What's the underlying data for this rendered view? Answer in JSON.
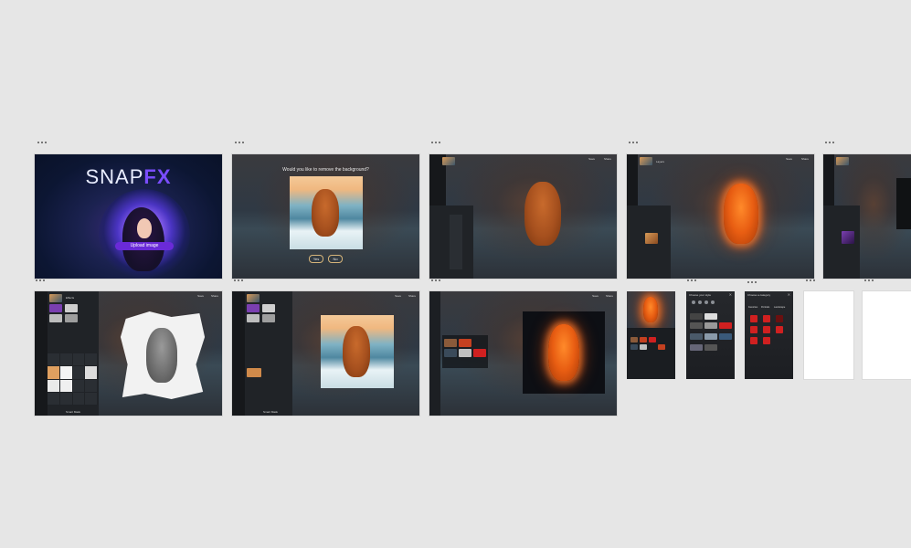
{
  "colors": {
    "canvas_bg": "#e6e6e6",
    "accent_purple": "#7a4dff",
    "button_purple": "#6a2ad8",
    "panel_dark": "#1f2328"
  },
  "splash": {
    "title_main": "SNAP",
    "title_fx": "FX",
    "cta_label": "Upload image"
  },
  "remove_bg_dialog": {
    "question": "Would you like to remove the background?",
    "yes_label": "Yes",
    "no_label": "No"
  },
  "editor": {
    "top_right_save": "Save",
    "top_right_share": "Share",
    "tab_effects": "Effects",
    "tab_layers": "Layers",
    "side_labels": [
      "Adjust",
      "Overlays",
      "Stickers"
    ],
    "bottom_hint": "Smart Mask"
  },
  "phone": {
    "filter_header": "Choose your style",
    "category_header": "Choose a category",
    "cat_tabs": [
      "Favorites",
      "Portraits",
      "Landscape",
      "Artistic"
    ]
  },
  "icons": [
    "dots-icon",
    "menu-icon",
    "save-icon",
    "share-icon",
    "close-icon",
    "bulb-icon"
  ]
}
